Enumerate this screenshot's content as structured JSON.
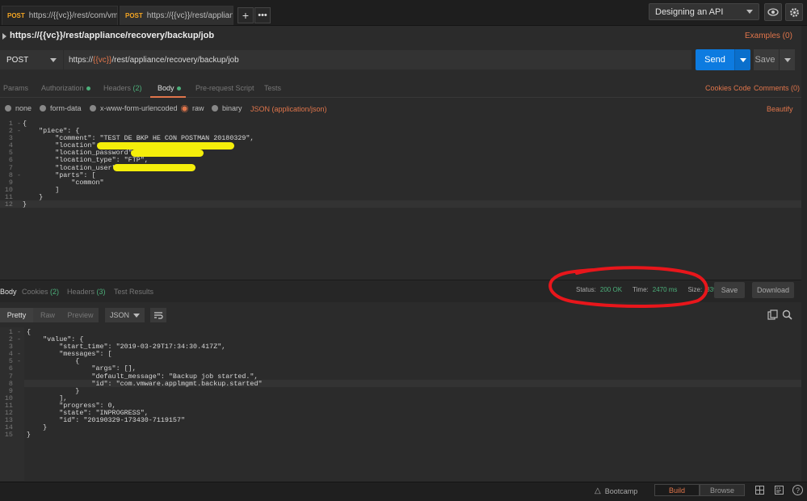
{
  "tabs": [
    {
      "method": "POST",
      "url": "https://{{vc}}/rest/com/vmware/cis/"
    },
    {
      "method": "POST",
      "url": "https://{{vc}}/rest/appliance/rec"
    }
  ],
  "environment": {
    "selected": "Designing an API"
  },
  "request": {
    "title": "https://{{vc}}/rest/appliance/recovery/backup/job",
    "examples_label": "Examples (0)",
    "method": "POST",
    "url_prefix": "https://",
    "url_var": "{{vc}}",
    "url_suffix": "/rest/appliance/recovery/backup/job",
    "send_label": "Send",
    "save_label": "Save"
  },
  "request_tabs": {
    "params": "Params",
    "authorization": "Authorization",
    "headers": "Headers",
    "headers_count": "(2)",
    "body": "Body",
    "prerequest": "Pre-request Script",
    "tests": "Tests",
    "cookies": "Cookies",
    "code": "Code",
    "comments": "Comments (0)"
  },
  "body_types": {
    "none": "none",
    "form_data": "form-data",
    "urlencoded": "x-www-form-urlencoded",
    "raw": "raw",
    "binary": "binary",
    "json_type": "JSON (application/json)",
    "beautify": "Beautify"
  },
  "request_body_lines": [
    "{",
    "    \"piece\": {",
    "        \"comment\": \"TEST DE BKP HE CON POSTMAN 20180329\",",
    "        \"location\": \"",
    "        \"location_password\": \"",
    "        \"location_type\": \"FTP\",",
    "        \"location_user\": \"",
    "        \"parts\": [",
    "            \"common\"",
    "        ]",
    "    }",
    "}"
  ],
  "response_tabs": {
    "body": "Body",
    "cookies": "Cookies",
    "cookies_count": "(2)",
    "headers": "Headers",
    "headers_count": "(3)",
    "tests": "Test Results"
  },
  "status": {
    "status_label": "Status:",
    "status_value": "200 OK",
    "time_label": "Time:",
    "time_value": "2470 ms",
    "size_label": "Size:",
    "size_value": "339 B",
    "save_label": "Save",
    "download_label": "Download"
  },
  "view": {
    "pretty": "Pretty",
    "raw": "Raw",
    "preview": "Preview",
    "format": "JSON"
  },
  "response_body_lines": [
    "{",
    "    \"value\": {",
    "        \"start_time\": \"2019-03-29T17:34:30.417Z\",",
    "        \"messages\": [",
    "            {",
    "                \"args\": [],",
    "                \"default_message\": \"Backup job started.\",",
    "                \"id\": \"com.vmware.applmgmt.backup.started\"",
    "            }",
    "        ],",
    "        \"progress\": 0,",
    "        \"state\": \"INPROGRESS\",",
    "        \"id\": \"20190329-173430-7119157\"",
    "    }",
    "}"
  ],
  "footer": {
    "bootcamp": "Bootcamp",
    "build": "Build",
    "browse": "Browse"
  },
  "colors": {
    "accent": "#e0754b",
    "send": "#0d7be0",
    "success": "#4caf7a",
    "annotation": "#e8161b"
  }
}
